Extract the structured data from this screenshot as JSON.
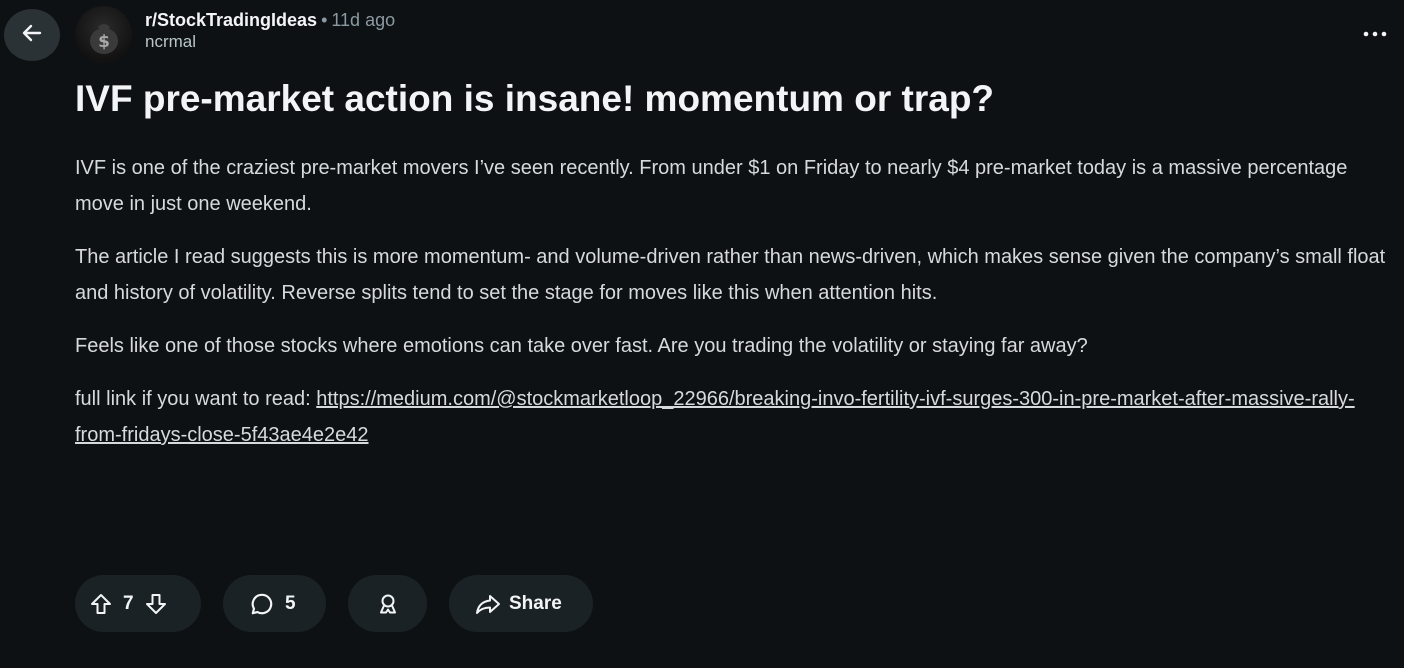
{
  "post": {
    "subreddit": "r/StockTradingIdeas",
    "separator": "•",
    "time_ago": "11d ago",
    "author": "ncrmal",
    "title": "IVF pre-market action is insane! momentum or trap?",
    "paragraphs": [
      "IVF is one of the craziest pre-market movers I’ve seen recently. From under $1 on Friday to nearly $4 pre-market today is a massive percentage move in just one weekend.",
      "The article I read suggests this is more momentum- and volume-driven rather than news-driven, which makes sense given the company’s small float and history of volatility. Reverse splits tend to set the stage for moves like this when attention hits.",
      "Feels like one of those stocks where emotions can take over fast. Are you trading the volatility or staying far away?"
    ],
    "link_prefix": "full link if you want to read: ",
    "link_text": "https://medium.com/@stockmarketloop_22966/breaking-invo-fertility-ivf-surges-300-in-pre-market-after-massive-rally-from-fridays-close-5f43ae4e2e42"
  },
  "actions": {
    "vote_count": "7",
    "comment_count": "5",
    "share_label": "Share"
  },
  "icons": {
    "back": "arrow-left-icon",
    "more": "more-horizontal-icon",
    "upvote": "upvote-arrow-icon",
    "downvote": "downvote-arrow-icon",
    "comment": "comment-bubble-icon",
    "award": "award-icon",
    "share": "share-arrow-icon"
  },
  "colors": {
    "background": "#0e1113",
    "pill": "#1a2226",
    "text": "#d7dadc",
    "muted": "#8a9aa3"
  }
}
